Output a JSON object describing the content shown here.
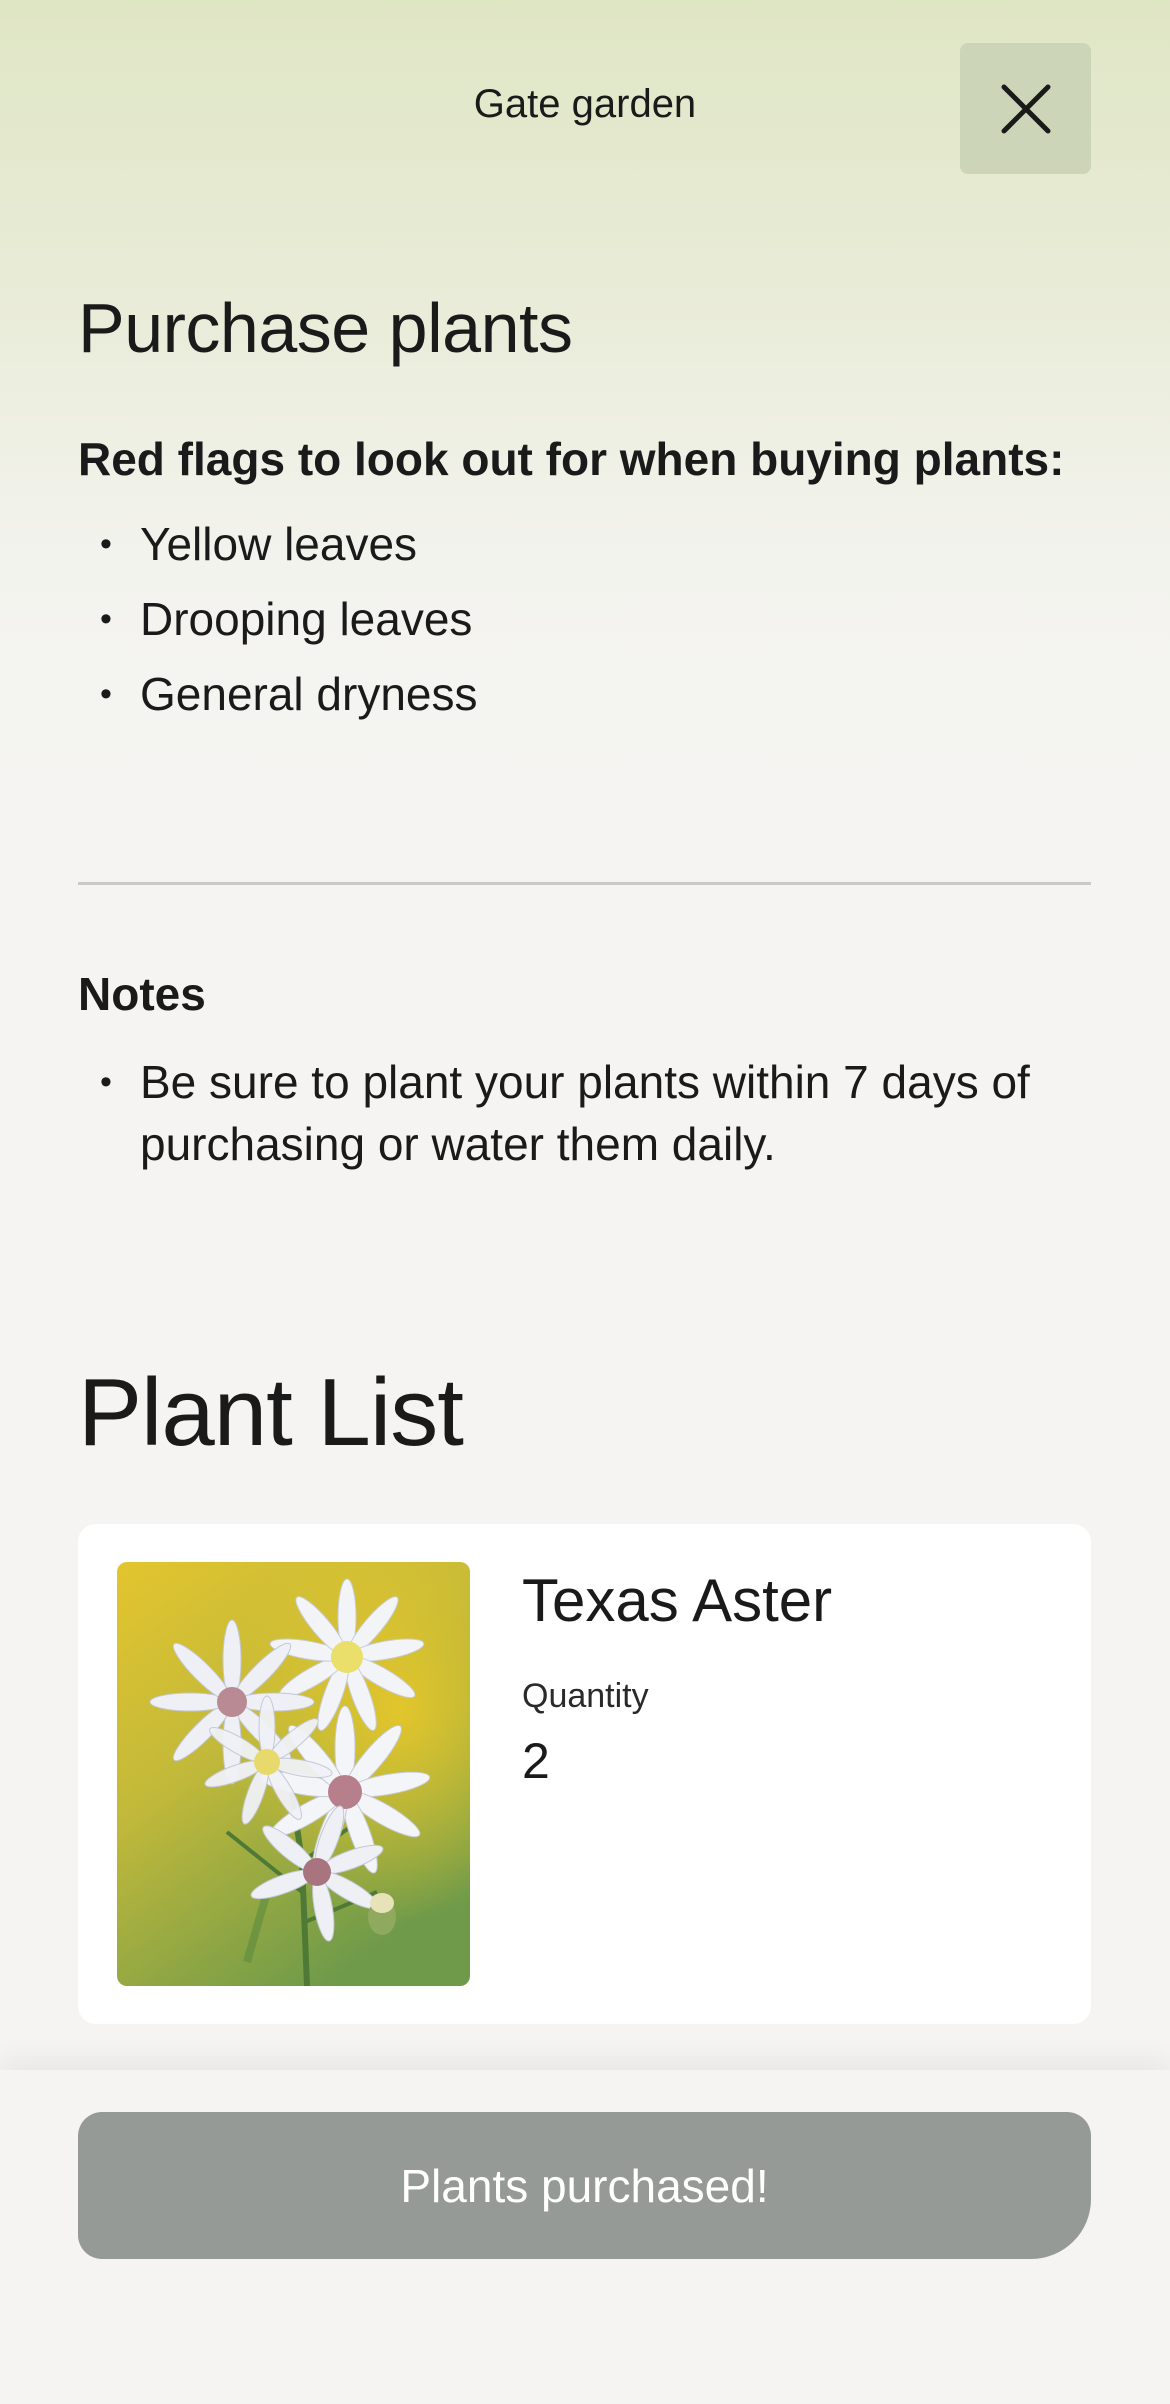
{
  "header": {
    "title": "Gate garden",
    "close_icon": "close-icon"
  },
  "purchase": {
    "title": "Purchase plants",
    "red_flags_heading": "Red flags to look out for when buying plants:",
    "red_flags": [
      "Yellow leaves",
      "Drooping leaves",
      "General dryness"
    ]
  },
  "notes": {
    "heading": "Notes",
    "items": [
      "Be sure to plant your plants within 7 days of purchasing or water them daily."
    ]
  },
  "plant_list": {
    "title": "Plant List",
    "plants": [
      {
        "name": "Texas Aster",
        "quantity_label": "Quantity",
        "quantity": "2"
      }
    ]
  },
  "footer": {
    "button_label": "Plants purchased!"
  },
  "colors": {
    "header_gradient_top": "#dfe6c4",
    "close_button_bg": "#cdd5b8",
    "page_bg": "#f5f4f2",
    "button_bg": "#969a96",
    "card_bg": "#ffffff"
  }
}
